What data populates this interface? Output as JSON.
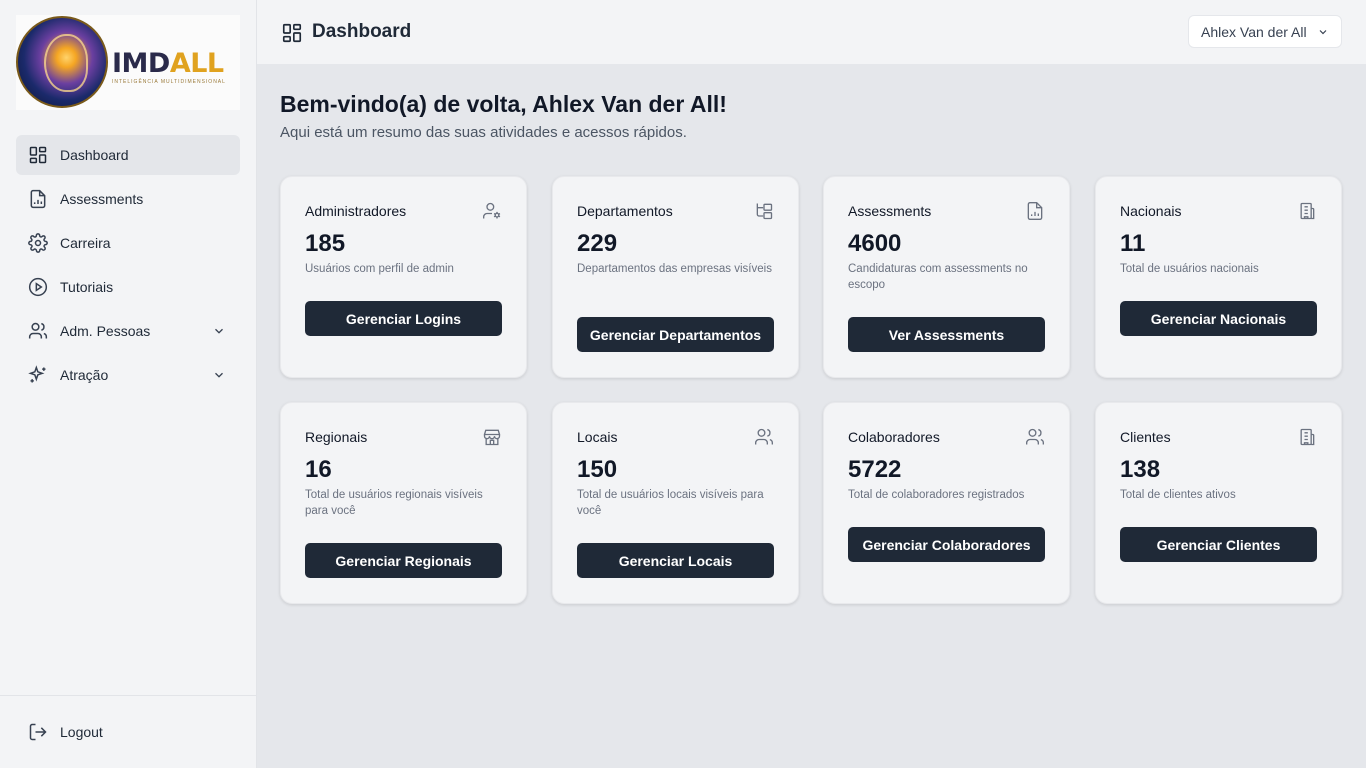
{
  "brand": {
    "name_part1": "IMD",
    "name_part2": "ALL",
    "tagline": "INTELIGÊNCIA MULTIDIMENSIONAL"
  },
  "sidebar": {
    "items": [
      {
        "label": "Dashboard",
        "icon": "layout-grid-icon",
        "active": true
      },
      {
        "label": "Assessments",
        "icon": "file-chart-icon"
      },
      {
        "label": "Carreira",
        "icon": "gear-icon"
      },
      {
        "label": "Tutoriais",
        "icon": "play-circle-icon"
      },
      {
        "label": "Adm. Pessoas",
        "icon": "users-icon",
        "expandable": true
      },
      {
        "label": "Atração",
        "icon": "sparkles-icon",
        "expandable": true
      }
    ],
    "logout_label": "Logout"
  },
  "header": {
    "title": "Dashboard",
    "user": "Ahlex Van der All"
  },
  "main": {
    "welcome": "Bem-vindo(a) de volta, Ahlex Van der All!",
    "subtitle": "Aqui está um resumo das suas atividades e acessos rápidos.",
    "cards": [
      {
        "title": "Administradores",
        "value": "185",
        "desc": "Usuários com perfil de admin",
        "button": "Gerenciar Logins",
        "icon": "user-cog-icon"
      },
      {
        "title": "Departamentos",
        "value": "229",
        "desc": "Departamentos das empresas visíveis",
        "button": "Gerenciar Departamentos",
        "icon": "folder-tree-icon"
      },
      {
        "title": "Assessments",
        "value": "4600",
        "desc": "Candidaturas com assessments no escopo",
        "button": "Ver Assessments",
        "icon": "file-chart-icon"
      },
      {
        "title": "Nacionais",
        "value": "11",
        "desc": "Total de usuários nacionais",
        "button": "Gerenciar Nacionais",
        "icon": "building-icon"
      },
      {
        "title": "Regionais",
        "value": "16",
        "desc": "Total de usuários regionais visíveis para você",
        "button": "Gerenciar Regionais",
        "icon": "store-icon"
      },
      {
        "title": "Locais",
        "value": "150",
        "desc": "Total de usuários locais visíveis para você",
        "button": "Gerenciar Locais",
        "icon": "users-icon"
      },
      {
        "title": "Colaboradores",
        "value": "5722",
        "desc": "Total de colaboradores registrados",
        "button": "Gerenciar Colaboradores",
        "icon": "users-icon"
      },
      {
        "title": "Clientes",
        "value": "138",
        "desc": "Total de clientes ativos",
        "button": "Gerenciar Clientes",
        "icon": "building-icon"
      }
    ]
  }
}
